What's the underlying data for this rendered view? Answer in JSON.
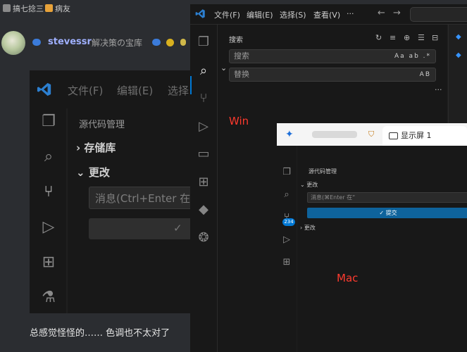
{
  "forum": {
    "tag1": "搞七捻三",
    "tag2": "病友",
    "username": "stevessr",
    "motto": "解决策の宝库",
    "comment": "总感觉怪怪的…… 色调也不太对了"
  },
  "big_screenshot": {
    "menu_file": "文件(F)",
    "menu_edit": "编辑(E)",
    "menu_select": "选择",
    "panel_title": "源代码管理",
    "section_repos": "存储库",
    "section_changes": "更改",
    "message_placeholder": "消息(Ctrl+Enter 在"
  },
  "win_window": {
    "menus": [
      "文件(F)",
      "编辑(E)",
      "选择(S)",
      "查看(V)",
      "···"
    ],
    "search_title": "搜索",
    "search_placeholder": "搜索",
    "search_options": "Aa ab .*",
    "replace_placeholder": "替换",
    "replace_option": "AB",
    "more": "···",
    "label": "Win"
  },
  "mac_window": {
    "tab_title": "显示屏 1",
    "panel_title": "源代码管理",
    "section_changes": "更改",
    "message_placeholder": "消息(⌘Enter 在“",
    "commit_label": "✓ 提交",
    "badge": "234",
    "folded_section": "更改",
    "label": "Mac"
  },
  "colors": {
    "accent": "#0078d4",
    "commit_button": "#0e639c",
    "annotation_text": "#ff3b2f"
  }
}
